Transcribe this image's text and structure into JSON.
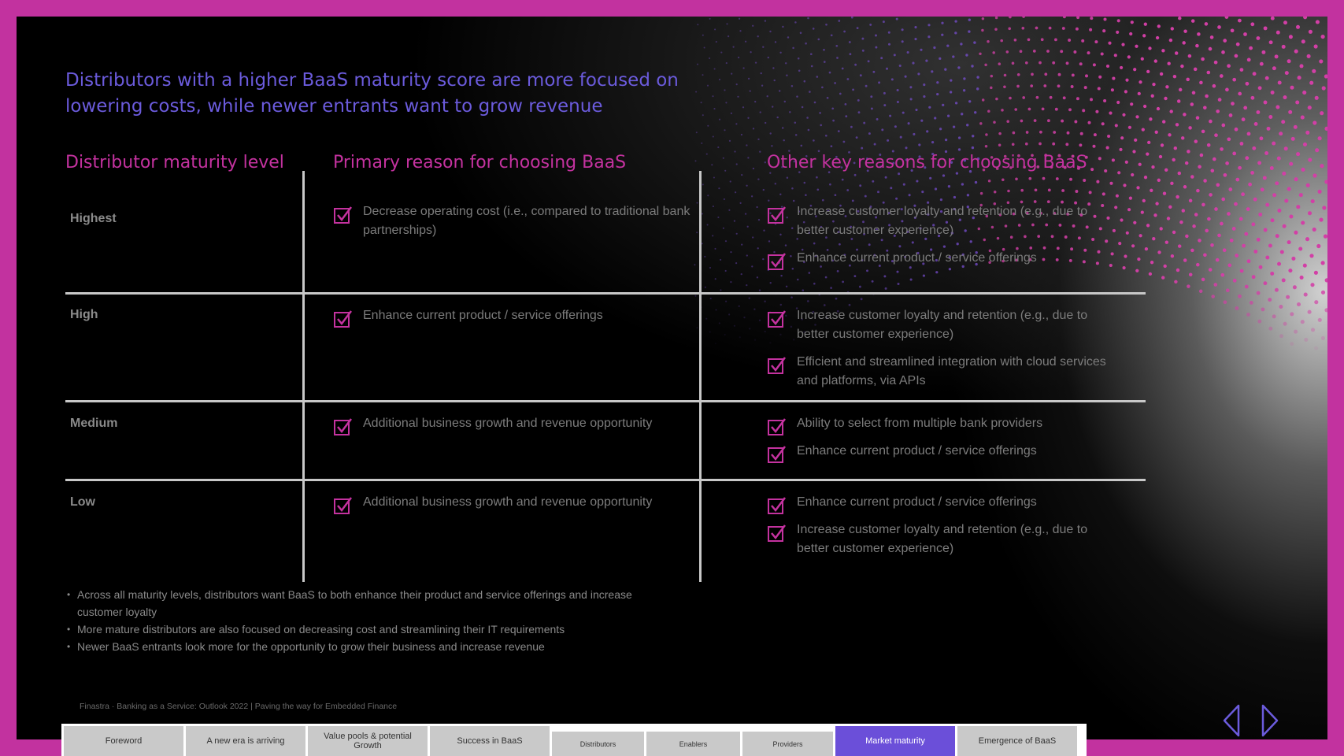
{
  "slide": {
    "headline": "Distributors with a higher BaaS maturity score are more focused on lowering costs, while newer entrants want to grow revenue",
    "columns": {
      "level": "Distributor maturity level",
      "primary": "Primary reason for choosing BaaS",
      "other": "Other key reasons for choosing BaaS"
    },
    "rows": [
      {
        "level": "Highest",
        "primary": [
          "Decrease operating cost (i.e., compared to traditional bank partnerships)"
        ],
        "other": [
          "Increase customer loyalty and retention (e.g., due to better customer experience)",
          "Enhance current product / service offerings"
        ]
      },
      {
        "level": "High",
        "primary": [
          "Enhance current product / service offerings"
        ],
        "other": [
          "Increase customer loyalty and retention (e.g., due to better customer experience)",
          "Efficient and streamlined integration with cloud services and platforms, via APIs"
        ]
      },
      {
        "level": "Medium",
        "primary": [
          "Additional business growth and revenue opportunity"
        ],
        "other": [
          "Ability to select from multiple bank providers",
          "Enhance current product / service offerings"
        ]
      },
      {
        "level": "Low",
        "primary": [
          "Additional business growth and revenue opportunity"
        ],
        "other": [
          "Enhance current product / service offerings",
          "Increase customer loyalty and retention (e.g., due to better customer experience)"
        ]
      }
    ],
    "bullets": [
      "Across all maturity levels, distributors want BaaS to both enhance their product and service offerings and increase customer loyalty",
      "More mature distributors are also focused on decreasing cost and streamlining their IT requirements",
      "Newer BaaS entrants look more for the opportunity to grow their business and increase revenue"
    ],
    "footer": "Finastra · Banking as a Service: Outlook 2022 | Paving the way for Embedded Finance"
  },
  "nav": {
    "tabs": [
      {
        "label": "Foreword",
        "active": false
      },
      {
        "label": "A new era is arriving",
        "active": false
      },
      {
        "label": "Value pools & potential Growth",
        "active": false
      },
      {
        "label": "Success in BaaS",
        "active": false
      },
      {
        "label": "Distributors",
        "active": false
      },
      {
        "label": "Enablers",
        "active": false
      },
      {
        "label": "Providers",
        "active": false
      },
      {
        "label": "Market maturity",
        "active": true
      },
      {
        "label": "Emergence of BaaS",
        "active": false
      }
    ],
    "prev_icon": "chevron-left-icon",
    "next_icon": "chevron-right-icon"
  },
  "theme": {
    "frame": "#c2329f",
    "accent_pink": "#c4329f",
    "accent_purple": "#6b5bdc",
    "active_tab": "#6b4fd9"
  }
}
